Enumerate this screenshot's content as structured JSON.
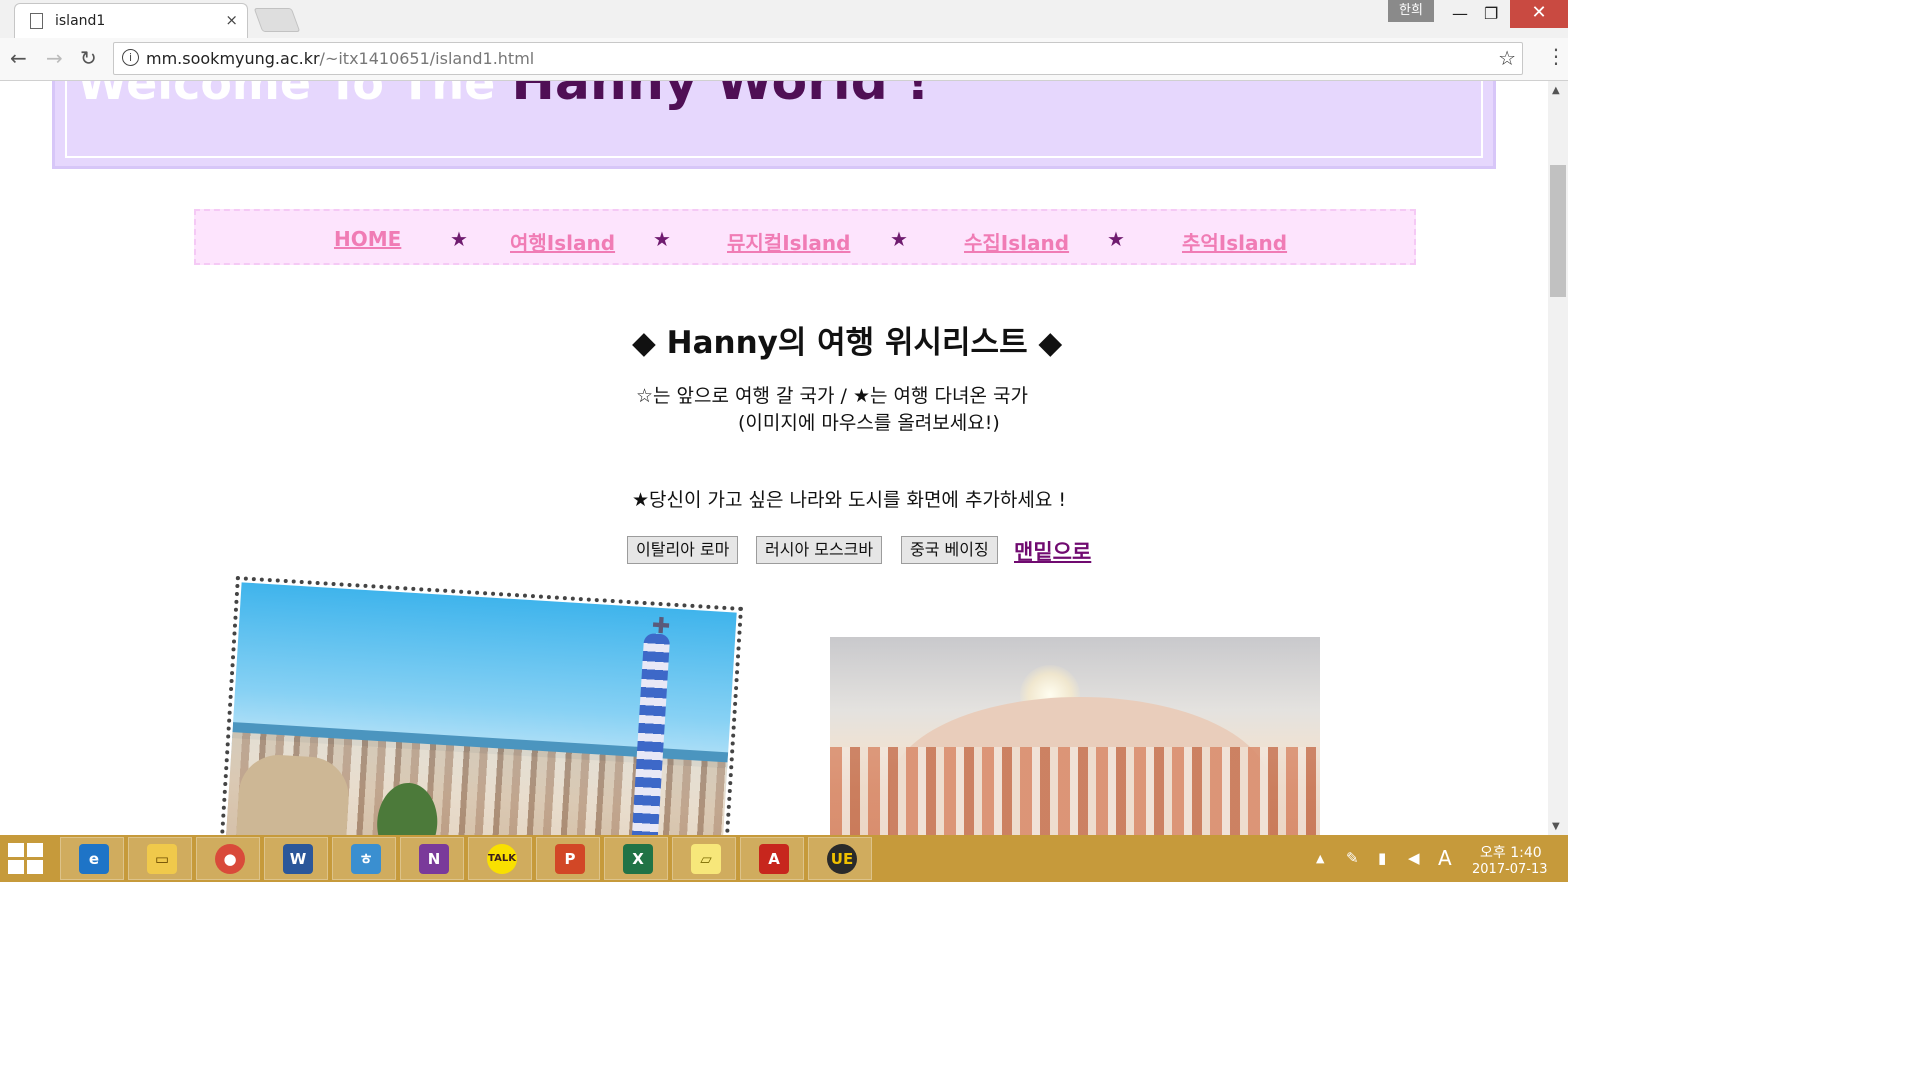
{
  "browser": {
    "tab_title": "island1",
    "tab_close": "×",
    "ime_badge": "한희",
    "url_host": "mm.sookmyung.ac.kr",
    "url_path": "/~itx1410651/island1.html",
    "window_controls": {
      "minimize": "—",
      "restore": "❐",
      "close": "✕"
    }
  },
  "page": {
    "banner": {
      "welcome": "Welcome To The ",
      "name": "Hanny World !"
    },
    "nav": {
      "items": [
        "HOME",
        "여행Island",
        "뮤지컬Island",
        "수집Island",
        "추억Island"
      ],
      "separator": "★"
    },
    "heading": "◆   Hanny의 여행 위시리스트   ◆",
    "legend_line1": "☆는 앞으로 여행 갈 국가 / ★는 여행 다녀온 국가",
    "legend_line2": "(이미지에 마우스를 올려보세요!)",
    "prompt": "★당신이 가고 싶은 나라와 도시를 화면에 추가하세요 !",
    "buttons": [
      "이탈리아 로마",
      "러시아 모스크바",
      "중국 베이징"
    ],
    "bottom_link": "맨밑으로"
  },
  "taskbar": {
    "apps": [
      "ie-icon",
      "file-explorer-icon",
      "chrome-icon",
      "word-icon",
      "hangul-icon",
      "onenote-icon",
      "kakaotalk-icon",
      "powerpoint-icon",
      "excel-icon",
      "sticky-notes-icon",
      "acrobat-icon",
      "ultraedit-icon"
    ],
    "ime_mode": "A",
    "time": "오후 1:40",
    "date": "2017-07-13"
  }
}
